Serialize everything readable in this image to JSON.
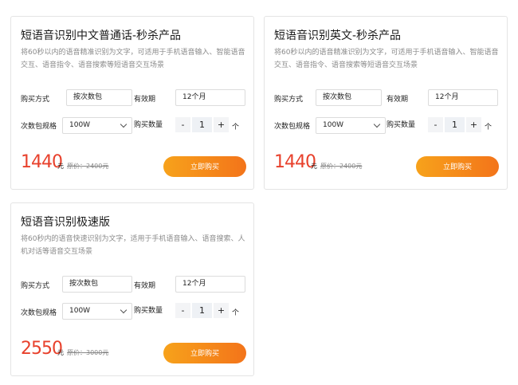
{
  "cards": [
    {
      "title": "短语音识别中文普通话-秒杀产品",
      "desc": "将60秒以内的语音精准识别为文字，可适用于手机语音输入、智能语音交互、语音指令、语音搜索等短语音交互场景",
      "buy_label": "购买方式",
      "buy_value": "按次数包",
      "validity_label": "有效期",
      "validity_value": "12个月",
      "spec_label": "次数包规格",
      "spec_value": "100W",
      "qty_label": "购买数量",
      "qty_minus": "-",
      "qty_value": "1",
      "qty_plus": "+",
      "qty_unit": "个",
      "price": "1440",
      "price_unit": "元",
      "orig_price": "原价：2400元",
      "button": "立即购买"
    },
    {
      "title": "短语音识别英文-秒杀产品",
      "desc": "将60秒以内的语音精准识别为文字，可适用于手机语音输入、智能语音交互、语音指令、语音搜索等短语音交互场景",
      "buy_label": "购买方式",
      "buy_value": "按次数包",
      "validity_label": "有效期",
      "validity_value": "12个月",
      "spec_label": "次数包规格",
      "spec_value": "100W",
      "qty_label": "购买数量",
      "qty_minus": "-",
      "qty_value": "1",
      "qty_plus": "+",
      "qty_unit": "个",
      "price": "1440",
      "price_unit": "元",
      "orig_price": "原价：2400元",
      "button": "立即购买"
    },
    {
      "title": "短语音识别极速版",
      "desc": "将60秒内的语音快速识别为文字，适用于手机语音输入、语音搜索、人机对话等语音交互场景",
      "buy_label": "购买方式",
      "buy_value": "按次数包",
      "validity_label": "有效期",
      "validity_value": "12个月",
      "spec_label": "次数包规格",
      "spec_value": "100W",
      "qty_label": "购买数量",
      "qty_minus": "-",
      "qty_value": "1",
      "qty_plus": "+",
      "qty_unit": "个",
      "price": "2550",
      "price_unit": "元",
      "orig_price": "原价：3000元",
      "button": "立即购买"
    }
  ]
}
